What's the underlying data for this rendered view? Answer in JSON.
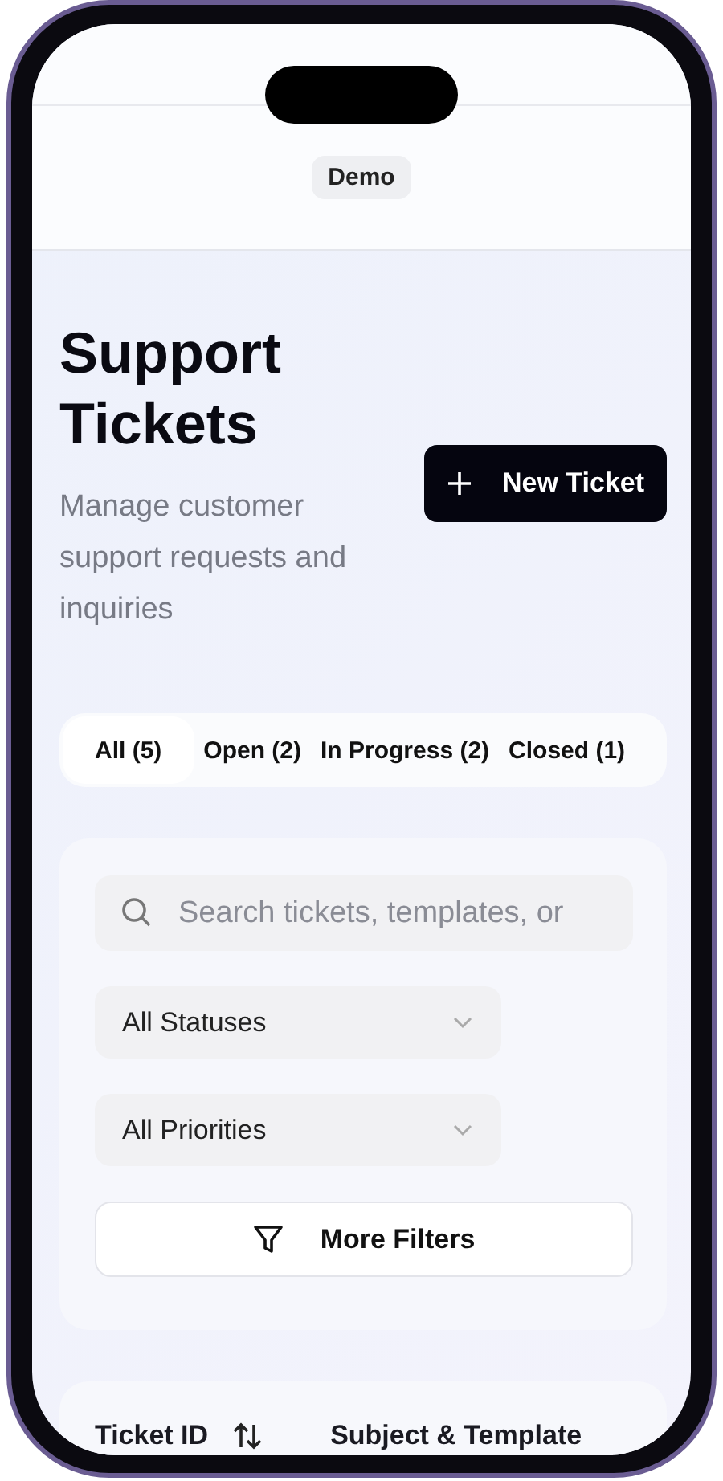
{
  "header": {
    "badge": "Demo"
  },
  "page": {
    "title": "Support Tickets",
    "subtitle": "Manage customer support requests and inquiries",
    "new_button": {
      "label": "New Ticket"
    }
  },
  "tabs": [
    {
      "label": "All (5)",
      "selected": true
    },
    {
      "label": "Open (2)",
      "selected": false
    },
    {
      "label": "In Progress (2)",
      "selected": false
    },
    {
      "label": "Closed (1)",
      "selected": false
    }
  ],
  "filters": {
    "search": {
      "placeholder": "Search tickets, templates, or"
    },
    "selects": [
      {
        "value": "All Statuses"
      },
      {
        "value": "All Priorities"
      }
    ],
    "more_button": {
      "label": "More Filters"
    }
  },
  "table": {
    "columns": [
      {
        "label": "Ticket ID",
        "sortable": true
      },
      {
        "label": "Subject & Template",
        "sortable": false
      }
    ]
  }
}
